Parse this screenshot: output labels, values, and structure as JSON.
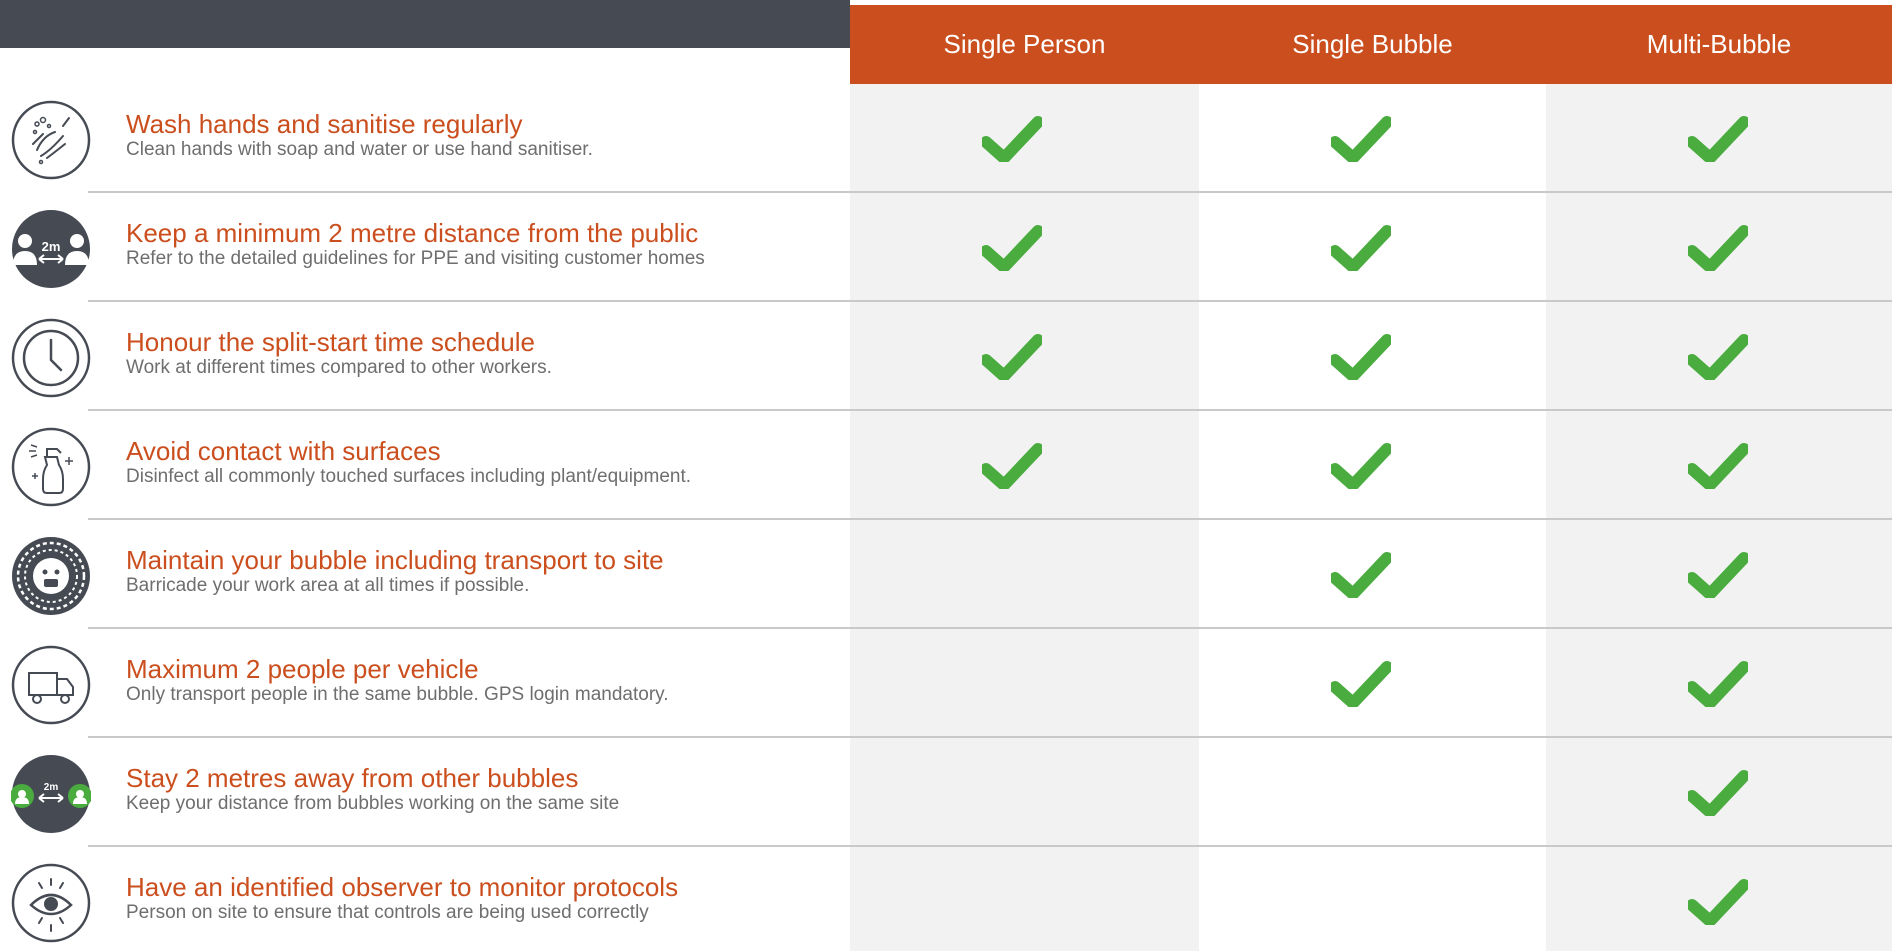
{
  "header": {
    "columns": [
      "Single Person",
      "Single Bubble",
      "Multi-Bubble"
    ]
  },
  "colors": {
    "accent": "#cb4f1e",
    "dark_bar": "#454a53",
    "check": "#4aac3f",
    "column_shade": "#f2f2f2",
    "description_text": "#6e6e6e"
  },
  "rows": [
    {
      "icon": "hand-wash-icon",
      "title": "Wash hands and sanitise regularly",
      "description": "Clean hands with soap and water or use hand sanitiser.",
      "single_person": true,
      "single_bubble": true,
      "multi_bubble": true
    },
    {
      "icon": "distance-2m-icon",
      "icon_label": "2m",
      "title": "Keep a minimum 2 metre distance from the public",
      "description": "Refer to the detailed guidelines for PPE and visiting customer homes",
      "single_person": true,
      "single_bubble": true,
      "multi_bubble": true
    },
    {
      "icon": "clock-icon",
      "title": "Honour the split-start time schedule",
      "description": "Work at different times compared to other workers.",
      "single_person": true,
      "single_bubble": true,
      "multi_bubble": true
    },
    {
      "icon": "spray-bottle-icon",
      "title": "Avoid contact with surfaces",
      "description": "Disinfect all commonly touched surfaces including plant/equipment.",
      "single_person": true,
      "single_bubble": true,
      "multi_bubble": true
    },
    {
      "icon": "bubble-face-icon",
      "title": "Maintain your bubble including transport to site",
      "description": "Barricade your work area at all times if possible.",
      "single_person": false,
      "single_bubble": true,
      "multi_bubble": true
    },
    {
      "icon": "truck-icon",
      "title": "Maximum 2 people per vehicle",
      "description": "Only transport people in the same bubble. GPS login mandatory.",
      "single_person": false,
      "single_bubble": true,
      "multi_bubble": true
    },
    {
      "icon": "bubbles-distance-icon",
      "icon_label": "2m",
      "title": "Stay 2 metres away from other bubbles",
      "description": "Keep your distance from bubbles working on the same site",
      "single_person": false,
      "single_bubble": false,
      "multi_bubble": true
    },
    {
      "icon": "eye-icon",
      "title": "Have an identified observer to monitor protocols",
      "description": "Person on site to ensure that controls are being used correctly",
      "single_person": false,
      "single_bubble": false,
      "multi_bubble": true
    }
  ]
}
